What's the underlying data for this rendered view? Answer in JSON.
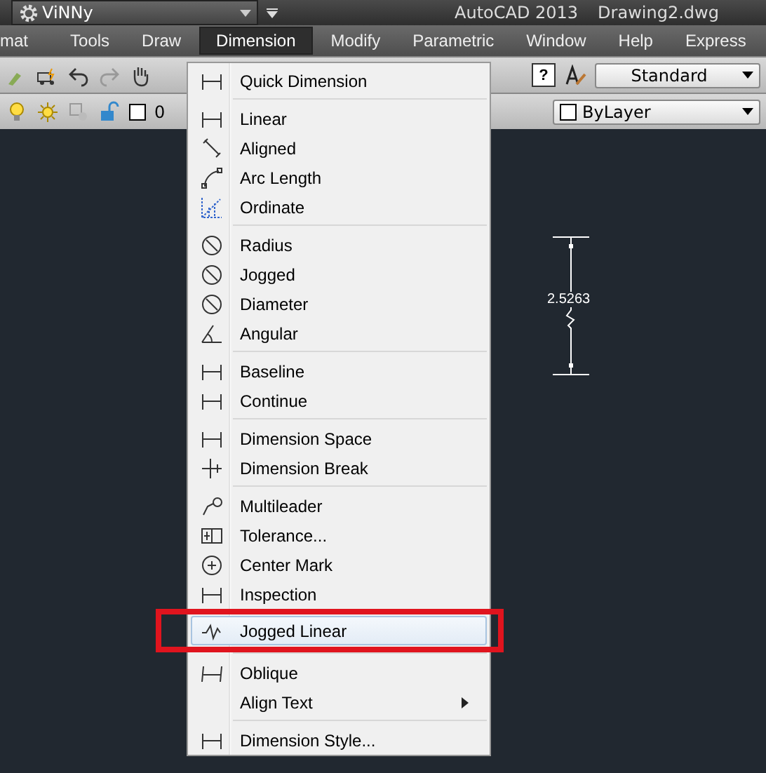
{
  "title_bar": {
    "workspace": "ViNNy",
    "app_title": "AutoCAD 2013",
    "file_name": "Drawing2.dwg"
  },
  "menu_bar": [
    {
      "label": "mat",
      "selected": false
    },
    {
      "label": "Tools",
      "selected": false
    },
    {
      "label": "Draw",
      "selected": false
    },
    {
      "label": "Dimension",
      "selected": true
    },
    {
      "label": "Modify",
      "selected": false
    },
    {
      "label": "Parametric",
      "selected": false
    },
    {
      "label": "Window",
      "selected": false
    },
    {
      "label": "Help",
      "selected": false
    },
    {
      "label": "Express",
      "selected": false
    }
  ],
  "toolbar": {
    "help_label": "?",
    "text_style": "Standard",
    "layer": "0",
    "color_setting": "ByLayer"
  },
  "canvas": {
    "dimension_value": "2.5263"
  },
  "dimension_menu": [
    [
      {
        "label": "Quick Dimension",
        "selected": false,
        "submenu": false
      }
    ],
    [
      {
        "label": "Linear",
        "selected": false,
        "submenu": false
      },
      {
        "label": "Aligned",
        "selected": false,
        "submenu": false
      },
      {
        "label": "Arc Length",
        "selected": false,
        "submenu": false
      },
      {
        "label": "Ordinate",
        "selected": false,
        "submenu": false
      }
    ],
    [
      {
        "label": "Radius",
        "selected": false,
        "submenu": false
      },
      {
        "label": "Jogged",
        "selected": false,
        "submenu": false
      },
      {
        "label": "Diameter",
        "selected": false,
        "submenu": false
      },
      {
        "label": "Angular",
        "selected": false,
        "submenu": false
      }
    ],
    [
      {
        "label": "Baseline",
        "selected": false,
        "submenu": false
      },
      {
        "label": "Continue",
        "selected": false,
        "submenu": false
      }
    ],
    [
      {
        "label": "Dimension Space",
        "selected": false,
        "submenu": false
      },
      {
        "label": "Dimension Break",
        "selected": false,
        "submenu": false
      }
    ],
    [
      {
        "label": "Multileader",
        "selected": false,
        "submenu": false
      },
      {
        "label": "Tolerance...",
        "selected": false,
        "submenu": false
      },
      {
        "label": "Center Mark",
        "selected": false,
        "submenu": false
      },
      {
        "label": "Inspection",
        "selected": false,
        "submenu": false
      },
      {
        "label": "Jogged Linear",
        "selected": true,
        "submenu": false
      }
    ],
    [
      {
        "label": "Oblique",
        "selected": false,
        "submenu": false
      },
      {
        "label": "Align Text",
        "selected": false,
        "submenu": true
      }
    ],
    [
      {
        "label": "Dimension Style...",
        "selected": false
      }
    ]
  ]
}
